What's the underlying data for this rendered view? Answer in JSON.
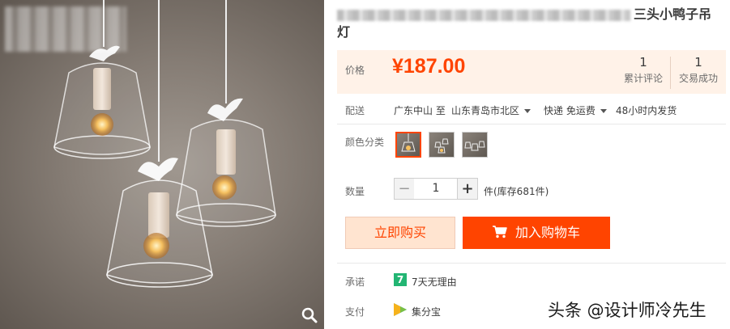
{
  "product": {
    "title_suffix": "三头小鸭子吊灯"
  },
  "price": {
    "label": "价格",
    "value": "¥187.00",
    "reviews_count": "1",
    "reviews_label": "累计评论",
    "sales_count": "1",
    "sales_label": "交易成功"
  },
  "shipping": {
    "label": "配送",
    "from": "广东中山 至",
    "to": "山东青岛市北区",
    "method": "快递 免运费",
    "dispatch": "48小时内发货"
  },
  "color": {
    "label": "颜色分类",
    "options": [
      "single-lamp",
      "three-lamp-cluster",
      "three-lamp-row"
    ],
    "selected": 0
  },
  "quantity": {
    "label": "数量",
    "value": "1",
    "stock": "件(库存681件)",
    "minus": "−",
    "plus": "+"
  },
  "actions": {
    "buy_now": "立即购买",
    "add_to_cart": "加入购物车"
  },
  "promise": {
    "label": "承诺",
    "icon_text": "7",
    "text": "7天无理由"
  },
  "payment": {
    "label": "支付",
    "text": "集分宝"
  },
  "watermark": "头条 @设计师冷先生",
  "colors": {
    "accent": "#ff4400",
    "price_bg": "#fff2e8",
    "buy_bg": "#ffe4d0",
    "promise_green": "#22b573"
  },
  "icons": {
    "zoom": "magnifier-icon",
    "cart": "cart-icon",
    "pay": "jifenbao-icon"
  }
}
